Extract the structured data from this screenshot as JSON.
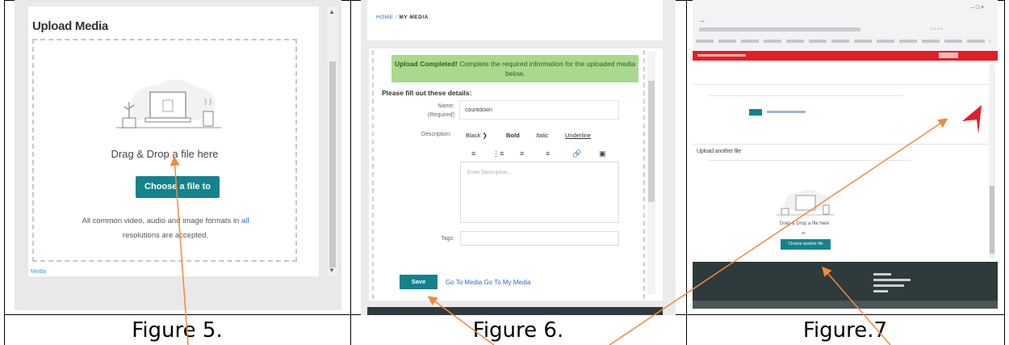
{
  "figure5": {
    "caption": "Figure 5.",
    "title": "Upload Media",
    "drag_text": "Drag & Drop a file here",
    "button_label": "Choose a file to upload",
    "formats_line1_pre": "All common video, audio and image formats in ",
    "formats_link": "all",
    "formats_line2": "resolutions are accepted.",
    "footnote": "Media"
  },
  "figure6": {
    "caption": "Figure 6.",
    "breadcrumb": {
      "home": "HOME",
      "separator": "/",
      "current": "MY MEDIA"
    },
    "banner_bold": "Upload Completed!",
    "banner_text": " Complete the required information for the uploaded media below.",
    "fill_heading": "Please fill out these details:",
    "name_label": "Name:",
    "required_label": "(Required)",
    "name_value": "countdown",
    "description_label": "Description:",
    "toolbar": {
      "format": "Black",
      "bold": "Bold",
      "italic": "Italic",
      "underline": "Underline"
    },
    "description_placeholder": "Enter Description...",
    "tags_label": "Tags:",
    "save_label": "Save",
    "link_go_media": "Go To Media",
    "link_go_my_media": "Go To My Media"
  },
  "figure7": {
    "caption": "Figure.7",
    "upload_another": "Upload another file",
    "drag_text": "Drag & Drop a file here",
    "or_text": "or",
    "choose_label": "Choose another file"
  },
  "colors": {
    "accent": "#14838c",
    "success_banner": "#a9d88f",
    "arrow": "#f08a3c",
    "footer": "#2e3a3c",
    "red_bar": "#e31e24"
  }
}
